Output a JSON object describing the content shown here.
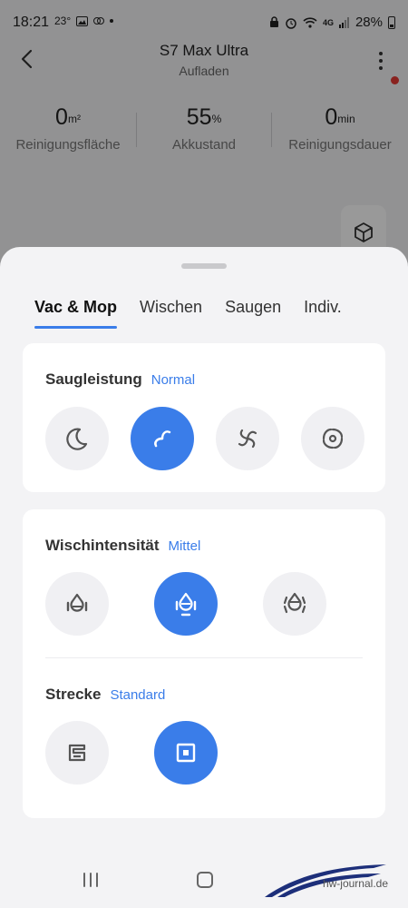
{
  "status_bar": {
    "time": "18:21",
    "temperature": "23°",
    "battery": "28%",
    "network": "4G"
  },
  "header": {
    "title": "S7 Max Ultra",
    "subtitle": "Aufladen"
  },
  "stats": [
    {
      "value": "0",
      "unit": "m²",
      "label": "Reinigungsfläche"
    },
    {
      "value": "55",
      "unit": "%",
      "label": "Akkustand"
    },
    {
      "value": "0",
      "unit": "min",
      "label": "Reinigungsdauer"
    }
  ],
  "tabs": [
    {
      "label": "Vac & Mop",
      "active": true
    },
    {
      "label": "Wischen",
      "active": false
    },
    {
      "label": "Saugen",
      "active": false
    },
    {
      "label": "Indiv.",
      "active": false
    }
  ],
  "suction": {
    "title": "Saugleistung",
    "value": "Normal",
    "options": [
      "moon-icon",
      "fan-normal-icon",
      "fan-turbo-icon",
      "fan-max-icon"
    ],
    "selected_index": 1
  },
  "mop_intensity": {
    "title": "Wischintensität",
    "value": "Mittel",
    "options": [
      "drop-low-icon",
      "drop-medium-icon",
      "drop-high-icon"
    ],
    "selected_index": 1
  },
  "route": {
    "title": "Strecke",
    "value": "Standard",
    "options": [
      "route-fine-icon",
      "route-standard-icon"
    ],
    "selected_index": 1
  },
  "watermark": "hw-journal.de",
  "colors": {
    "accent": "#3a7de9",
    "card": "#ffffff",
    "sheet": "#f3f3f5",
    "notification_dot": "#e53935"
  }
}
